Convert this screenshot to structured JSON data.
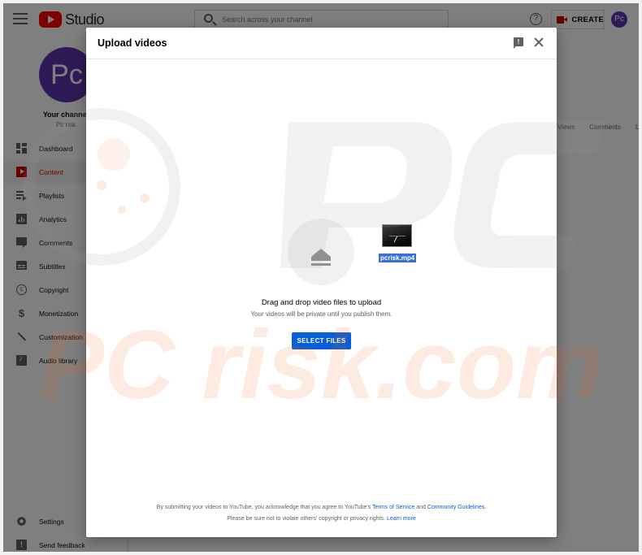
{
  "topbar": {
    "studio_label": "Studio",
    "search_placeholder": "Search across your channel",
    "create_label": "CREATE",
    "avatar_initials": "Pc"
  },
  "sidebar": {
    "avatar_initials": "Pc",
    "channel_title": "Your channel",
    "channel_handle": "Pc risk",
    "items": [
      {
        "label": "Dashboard",
        "icon": "dashboard-icon"
      },
      {
        "label": "Content",
        "icon": "content-icon",
        "active": true
      },
      {
        "label": "Playlists",
        "icon": "playlists-icon"
      },
      {
        "label": "Analytics",
        "icon": "analytics-icon"
      },
      {
        "label": "Comments",
        "icon": "comments-icon"
      },
      {
        "label": "Subtitles",
        "icon": "subtitles-icon"
      },
      {
        "label": "Copyright",
        "icon": "copyright-icon"
      },
      {
        "label": "Monetization",
        "icon": "monetization-icon"
      },
      {
        "label": "Customization",
        "icon": "customization-icon"
      },
      {
        "label": "Audio library",
        "icon": "audio-library-icon"
      }
    ],
    "bottom_items": [
      {
        "label": "Settings",
        "icon": "settings-icon"
      },
      {
        "label": "Send feedback",
        "icon": "feedback-icon"
      }
    ]
  },
  "content_columns": [
    "Views",
    "Comments",
    "Likes"
  ],
  "dialog": {
    "title": "Upload videos",
    "file_name": "pcrisk.mp4",
    "drop_heading": "Drag and drop video files to upload",
    "drop_sub": "Your videos will be private until you publish them.",
    "select_button": "SELECT FILES",
    "legal_prefix": "By submitting your videos to YouTube, you acknowledge that you agree to YouTube's",
    "terms_link": "Terms of Service",
    "legal_and": "and",
    "guidelines_link": "Community Guidelines",
    "legal_period": ".",
    "legal_line2": "Please be sure not to violate others' copyright or privacy rights.",
    "learn_more_link": "Learn more"
  },
  "colors": {
    "accent_red": "#cc0000",
    "link_blue": "#065fd4",
    "avatar_purple": "#5e35b1"
  },
  "watermark_text": "PC risk.com"
}
